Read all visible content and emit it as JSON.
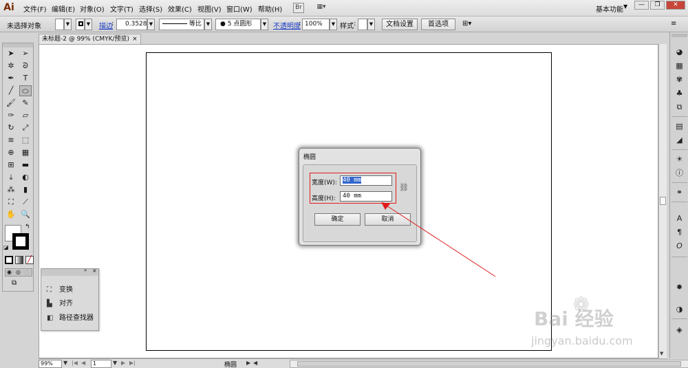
{
  "menubar": {
    "logo": "Ai",
    "items": [
      "文件(F)",
      "编辑(E)",
      "对象(O)",
      "文字(T)",
      "选择(S)",
      "效果(C)",
      "视图(V)",
      "窗口(W)",
      "帮助(H)"
    ],
    "bridge_btn": "Br",
    "arrange_btn": "▦▾",
    "workspace": "基本功能",
    "window_buttons": [
      "—",
      "❐",
      "✕"
    ]
  },
  "controlbar": {
    "selection_status": "未选择对象",
    "stroke_label": "描边",
    "stroke_weight": "0.3528",
    "stroke_profile": "等比",
    "brush": "5 点圆形",
    "opacity_label": "不透明度",
    "opacity_value": "100%",
    "style_label": "样式",
    "doc_setup_btn": "文档设置",
    "prefs_btn": "首选项"
  },
  "document": {
    "tab_title": "未标题-2 @ 99% (CMYK/预览)",
    "close": "×"
  },
  "statusbar": {
    "zoom": "99%",
    "page": "1",
    "current_tool": "椭圆"
  },
  "floating_panel": {
    "items": [
      {
        "label": "变换",
        "icon": "transform-icon"
      },
      {
        "label": "对齐",
        "icon": "align-icon"
      },
      {
        "label": "路径查找器",
        "icon": "pathfinder-icon"
      }
    ]
  },
  "dialog": {
    "title": "椭圆",
    "width_label": "宽度(W):",
    "width_value": "40 mm",
    "height_label": "高度(H):",
    "height_value": "40 mm",
    "ok_label": "确定",
    "cancel_label": "取消"
  },
  "watermark": {
    "brand": "Bai 经验",
    "url": "jingyan.baidu.com"
  },
  "colors": {
    "annotation_red": "#e01c1c",
    "selection_blue": "#3366cc"
  }
}
